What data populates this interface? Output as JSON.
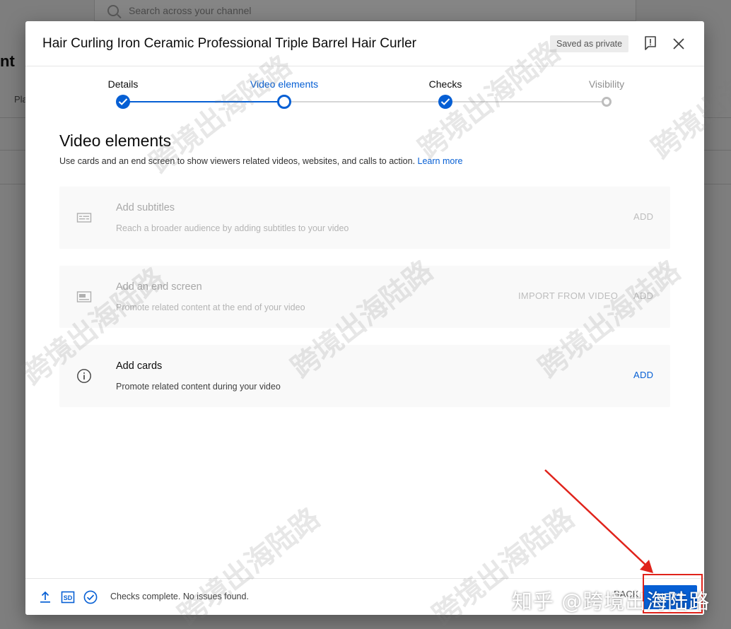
{
  "background": {
    "search_placeholder": "Search across your channel",
    "left_title_fragment": "nt",
    "left_tab_fragment": "Pla"
  },
  "dialog": {
    "title": "Hair Curling Iron Ceramic Professional Triple Barrel Hair Curler",
    "saved_badge": "Saved as private",
    "feedback_icon": "feedback-icon",
    "close_icon": "close-icon"
  },
  "stepper": {
    "steps": [
      {
        "label": "Details",
        "state": "done"
      },
      {
        "label": "Video elements",
        "state": "current"
      },
      {
        "label": "Checks",
        "state": "done"
      },
      {
        "label": "Visibility",
        "state": "todo"
      }
    ]
  },
  "content": {
    "title": "Video elements",
    "description": "Use cards and an end screen to show viewers related videos, websites, and calls to action.",
    "learn_more": "Learn more",
    "cards": [
      {
        "icon": "subtitles-icon",
        "title": "Add subtitles",
        "desc": "Reach a broader audience by adding subtitles to your video",
        "actions": [
          "ADD"
        ],
        "enabled": false
      },
      {
        "icon": "end-screen-icon",
        "title": "Add an end screen",
        "desc": "Promote related content at the end of your video",
        "actions": [
          "IMPORT FROM VIDEO",
          "ADD"
        ],
        "enabled": false
      },
      {
        "icon": "info-icon",
        "title": "Add cards",
        "desc": "Promote related content during your video",
        "actions": [
          "ADD"
        ],
        "enabled": true
      }
    ]
  },
  "footer": {
    "icons": [
      "upload-icon",
      "sd-icon",
      "checks-icon"
    ],
    "status": "Checks complete. No issues found.",
    "back_label": "BACK",
    "next_label": "NEXT"
  },
  "annotations": {
    "corner_watermark": "知乎 @跨境出海陆路",
    "repeated_watermark": "跨境出海陆路",
    "arrow_color": "#e0231b"
  },
  "colors": {
    "accent": "#065fd4",
    "annotation": "#e0231b"
  }
}
